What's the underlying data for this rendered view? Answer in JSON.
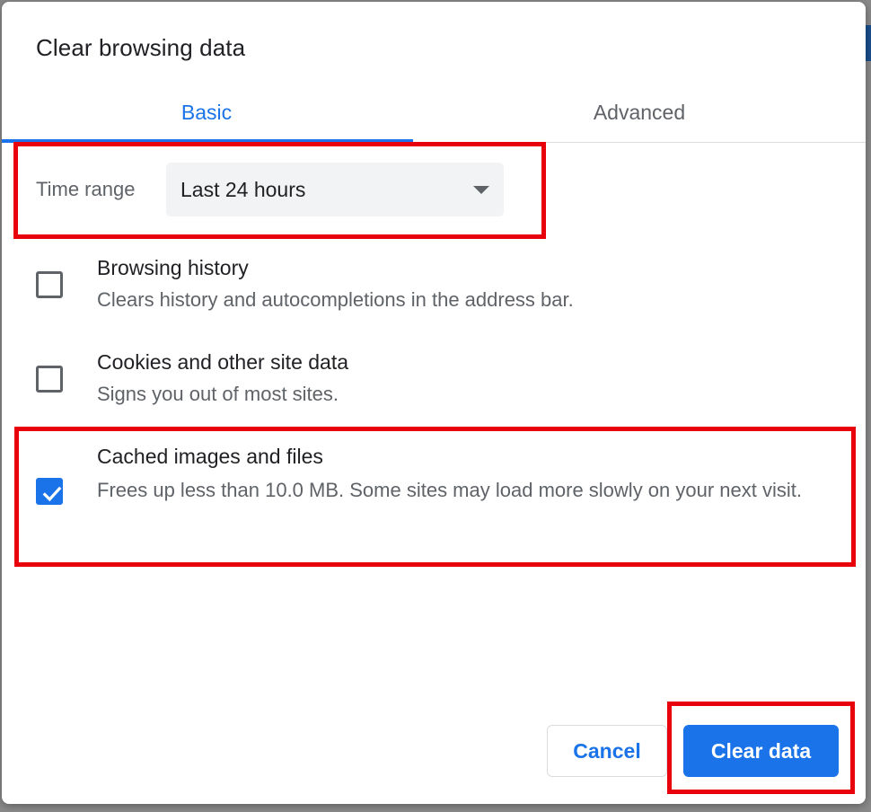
{
  "dialog": {
    "title": "Clear browsing data",
    "tabs": [
      {
        "label": "Basic",
        "active": true
      },
      {
        "label": "Advanced",
        "active": false
      }
    ],
    "time_range": {
      "label": "Time range",
      "selected": "Last 24 hours"
    },
    "items": [
      {
        "title": "Browsing history",
        "description": "Clears history and autocompletions in the address bar.",
        "checked": false
      },
      {
        "title": "Cookies and other site data",
        "description": "Signs you out of most sites.",
        "checked": false
      },
      {
        "title": "Cached images and files",
        "description": "Frees up less than 10.0 MB. Some sites may load more slowly on your next visit.",
        "checked": true
      }
    ],
    "buttons": {
      "cancel": "Cancel",
      "clear": "Clear data"
    }
  },
  "colors": {
    "accent": "#1a73e8",
    "highlight": "#e8000b",
    "text_primary": "#202124",
    "text_secondary": "#5f6368"
  },
  "icons": {
    "dropdown": "caret-down-icon",
    "check": "checkmark-icon"
  }
}
